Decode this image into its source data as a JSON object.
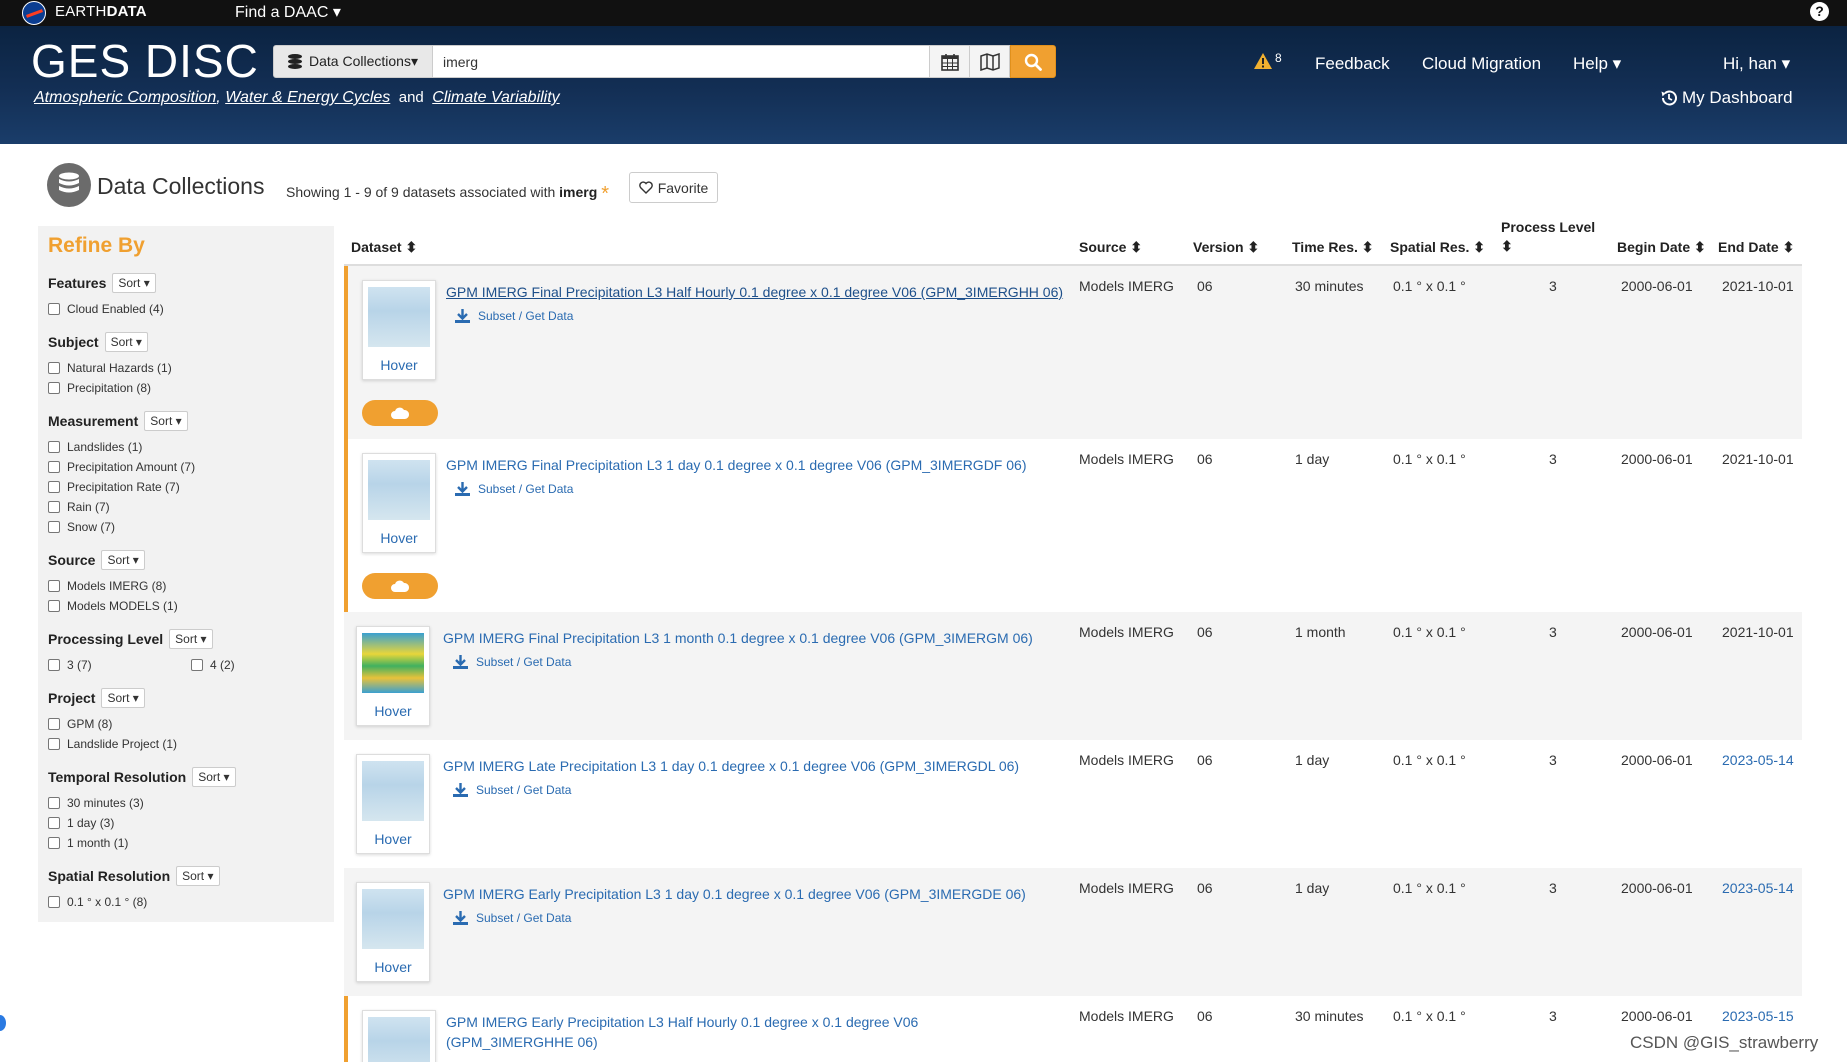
{
  "topbar": {
    "brand_bold": "EARTH",
    "brand_rest": "DATA",
    "find_daac": "Find a DAAC ▾",
    "help": "?"
  },
  "header": {
    "title": "GES DISC",
    "tagline": {
      "link1": "Atmospheric Composition",
      "sep1": ",",
      "link2": "Water & Energy Cycles",
      "and": "and",
      "link3": "Climate Variability"
    },
    "search": {
      "scope": "Data Collections▾",
      "value": "imerg",
      "placeholder": ""
    },
    "alert_count": "8",
    "nav": {
      "feedback": "Feedback",
      "cloud_migration": "Cloud Migration",
      "help": "Help ▾",
      "user": "Hi, han ▾",
      "dashboard": "My Dashboard"
    }
  },
  "page": {
    "title": "Data Collections",
    "showing_prefix": "Showing 1 - 9 of 9 datasets associated with",
    "query": "imerg",
    "asterisk": "*",
    "favorite": "Favorite"
  },
  "sidebar": {
    "title": "Refine By",
    "sort_label": "Sort ▾",
    "facets": [
      {
        "name": "Features",
        "options": [
          "Cloud Enabled (4)"
        ]
      },
      {
        "name": "Subject",
        "options": [
          "Natural Hazards (1)",
          "Precipitation (8)"
        ]
      },
      {
        "name": "Measurement",
        "options": [
          "Landslides (1)",
          "Precipitation Amount (7)",
          "Precipitation Rate (7)",
          "Rain (7)",
          "Snow (7)"
        ]
      },
      {
        "name": "Source",
        "options": [
          "Models IMERG (8)",
          "Models MODELS (1)"
        ]
      },
      {
        "name": "Processing Level",
        "options": [
          "3 (7)",
          "4 (2)"
        ]
      },
      {
        "name": "Project",
        "options": [
          "GPM (8)",
          "Landslide Project (1)"
        ]
      },
      {
        "name": "Temporal Resolution",
        "options": [
          "30 minutes (3)",
          "1 day (3)",
          "1 month (1)"
        ]
      },
      {
        "name": "Spatial Resolution",
        "options": [
          "0.1 ° x 0.1 ° (8)"
        ]
      }
    ]
  },
  "table": {
    "headers": {
      "dataset": "Dataset ⬍",
      "source": "Source ⬍",
      "version": "Version ⬍",
      "time_res": "Time Res. ⬍",
      "spatial_res": "Spatial Res. ⬍",
      "process_level": "Process Level",
      "process_level_sort": "⬍",
      "begin_date": "Begin Date ⬍",
      "end_date": "End Date ⬍"
    },
    "hover_label": "Hover",
    "subset_label": "Subset / Get Data",
    "rows": [
      {
        "title": "GPM IMERG Final Precipitation L3 Half Hourly 0.1 degree x 0.1 degree V06 (GPM_3IMERGHH 06)",
        "source": "Models IMERG",
        "version": "06",
        "time_res": "30 minutes",
        "spatial_res": "0.1 ° x 0.1 °",
        "level": "3",
        "begin": "2000-06-01",
        "end": "2021-10-01"
      },
      {
        "title": "GPM IMERG Final Precipitation L3 1 day 0.1 degree x 0.1 degree V06 (GPM_3IMERGDF 06)",
        "source": "Models IMERG",
        "version": "06",
        "time_res": "1 day",
        "spatial_res": "0.1 ° x 0.1 °",
        "level": "3",
        "begin": "2000-06-01",
        "end": "2021-10-01"
      },
      {
        "title": "GPM IMERG Final Precipitation L3 1 month 0.1 degree x 0.1 degree V06 (GPM_3IMERGM 06)",
        "source": "Models IMERG",
        "version": "06",
        "time_res": "1 month",
        "spatial_res": "0.1 ° x 0.1 °",
        "level": "3",
        "begin": "2000-06-01",
        "end": "2021-10-01"
      },
      {
        "title": "GPM IMERG Late Precipitation L3 1 day 0.1 degree x 0.1 degree V06 (GPM_3IMERGDL 06)",
        "source": "Models IMERG",
        "version": "06",
        "time_res": "1 day",
        "spatial_res": "0.1 ° x 0.1 °",
        "level": "3",
        "begin": "2000-06-01",
        "end": "2023-05-14"
      },
      {
        "title": "GPM IMERG Early Precipitation L3 1 day 0.1 degree x 0.1 degree V06 (GPM_3IMERGDE 06)",
        "source": "Models IMERG",
        "version": "06",
        "time_res": "1 day",
        "spatial_res": "0.1 ° x 0.1 °",
        "level": "3",
        "begin": "2000-06-01",
        "end": "2023-05-14"
      },
      {
        "title_l1": "GPM IMERG Early Precipitation L3 Half Hourly 0.1 degree x 0.1 degree V06",
        "title_l2": "(GPM_3IMERGHHE 06)",
        "source": "Models IMERG",
        "version": "06",
        "time_res": "30 minutes",
        "spatial_res": "0.1 ° x 0.1 °",
        "level": "3",
        "begin": "2000-06-01",
        "end": "2023-05-15"
      }
    ]
  },
  "watermark": "CSDN @GIS_strawberry",
  "colors": {
    "accent": "#f0a030",
    "link": "#2a6bb1",
    "header_bg": "#132f55"
  }
}
